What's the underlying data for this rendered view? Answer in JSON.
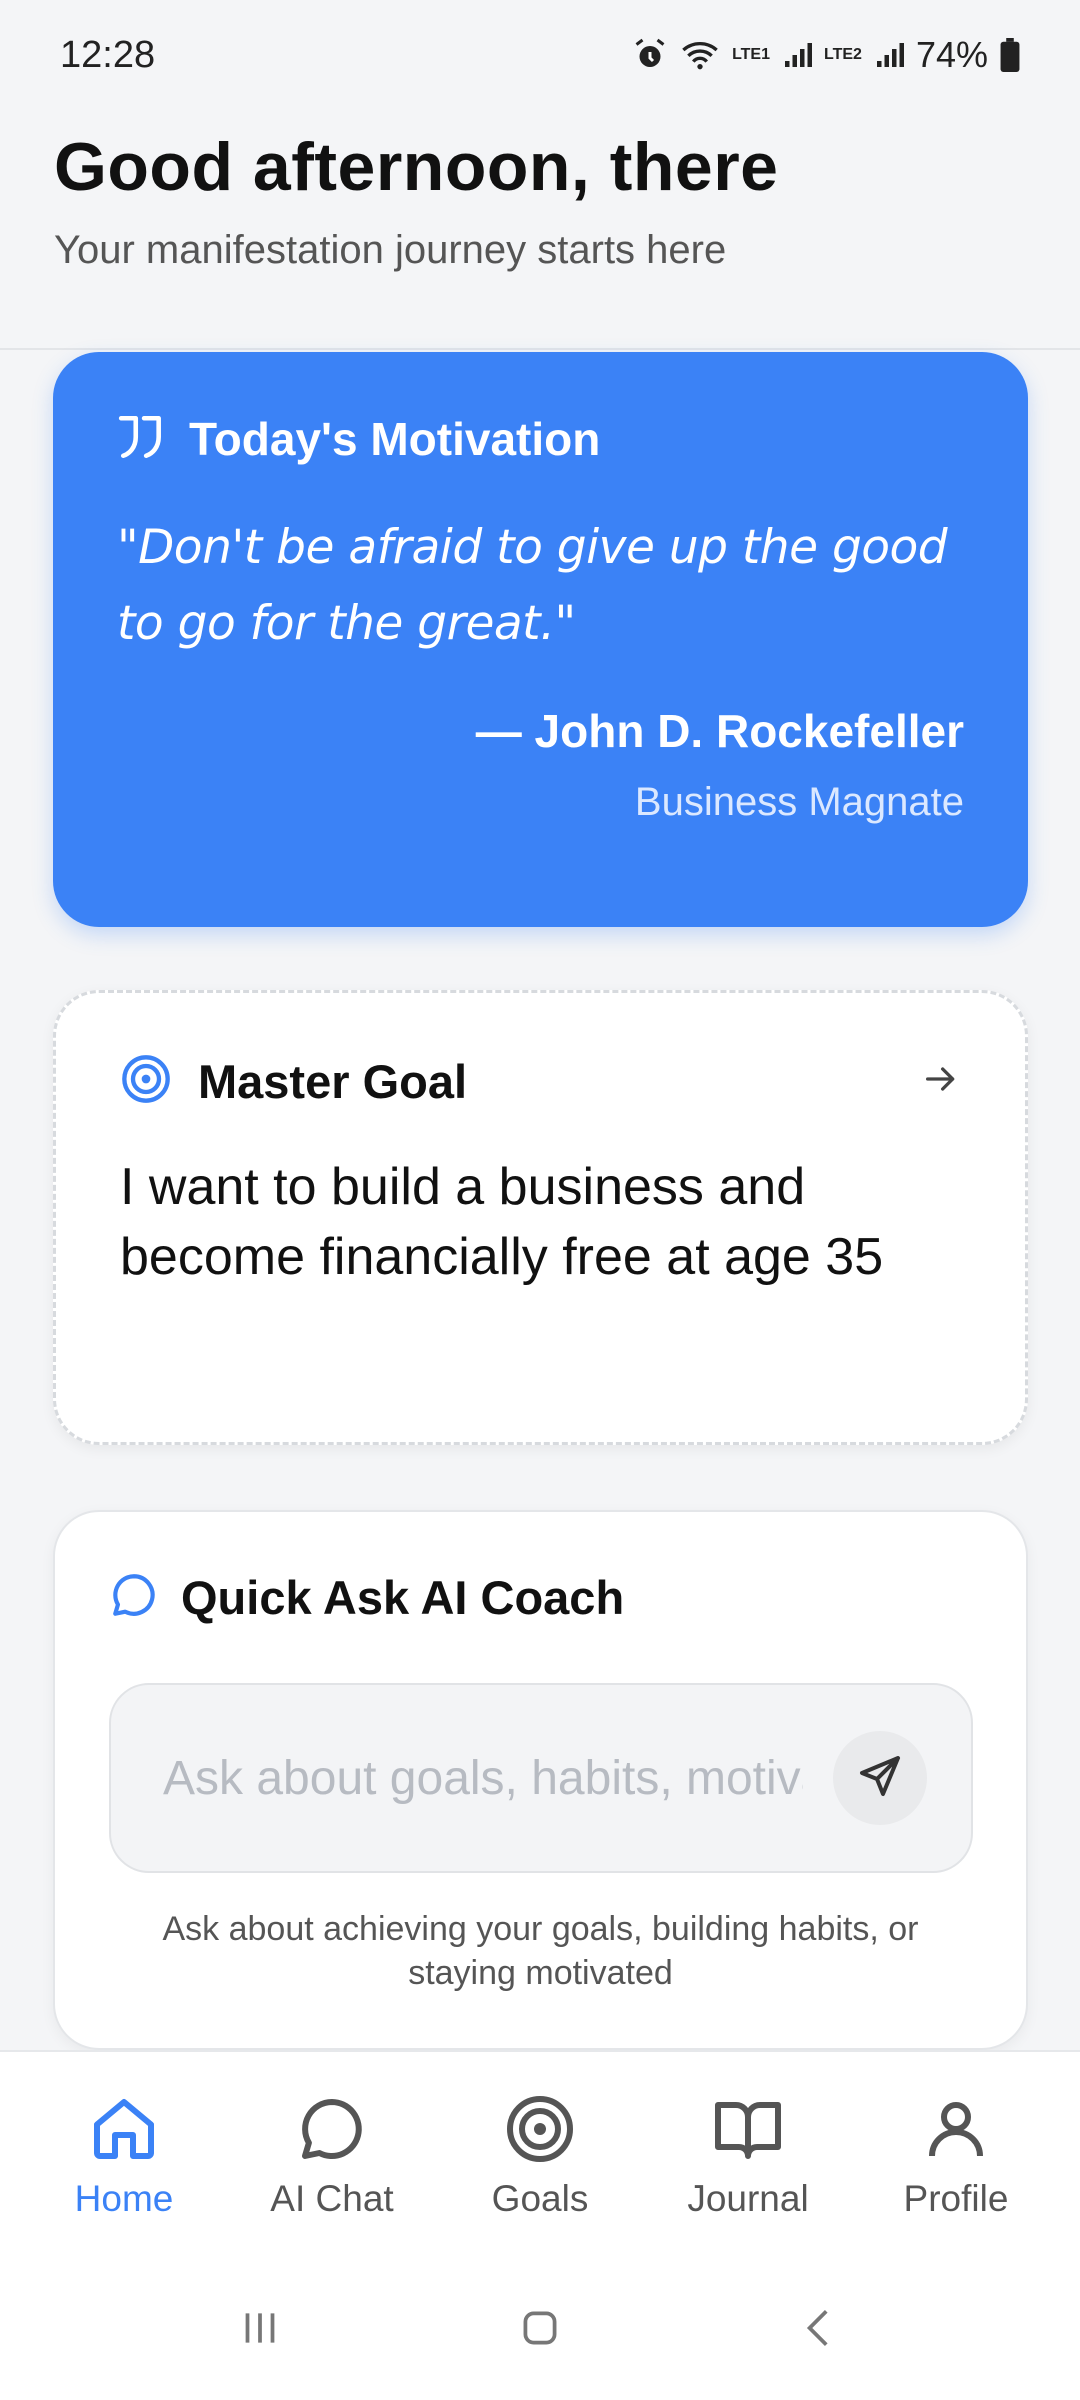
{
  "status_bar": {
    "time": "12:28",
    "lte1": "LTE1",
    "lte2": "LTE2",
    "battery": "74%"
  },
  "header": {
    "greeting": "Good afternoon, there",
    "subtitle": "Your manifestation journey starts here"
  },
  "motivation": {
    "title": "Today's Motivation",
    "quote": "\"Don't be afraid to give up the good to go for the great.\"",
    "author": "— John D. Rockefeller",
    "role": "Business Magnate",
    "accent_color": "#3b82f6"
  },
  "master_goal": {
    "title": "Master Goal",
    "text": "I want to build a business and become financially free at age 35"
  },
  "ai_coach": {
    "title": "Quick Ask AI Coach",
    "placeholder": "Ask about goals, habits, motivation...",
    "hint": "Ask about achieving your goals, building habits, or staying motivated"
  },
  "bottom_nav": {
    "items": [
      {
        "label": "Home",
        "icon": "home-icon",
        "active": true
      },
      {
        "label": "AI Chat",
        "icon": "chat-icon",
        "active": false
      },
      {
        "label": "Goals",
        "icon": "target-icon",
        "active": false
      },
      {
        "label": "Journal",
        "icon": "book-icon",
        "active": false
      },
      {
        "label": "Profile",
        "icon": "user-icon",
        "active": false
      }
    ]
  }
}
